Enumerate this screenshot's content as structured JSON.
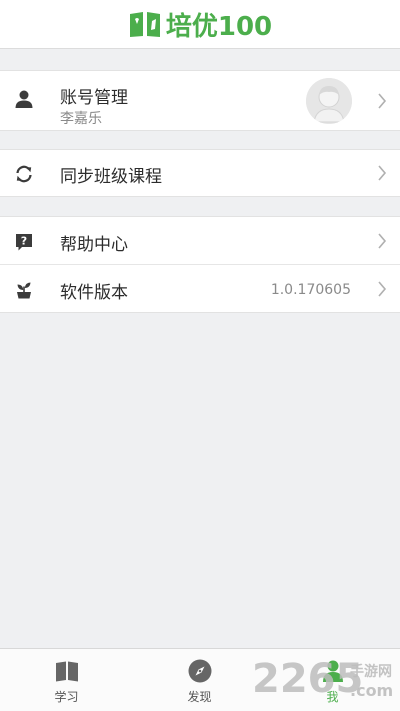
{
  "header": {
    "app_title": "培优100",
    "logo_icon": "book-logo-icon",
    "brand_color": "#4cae4c"
  },
  "account": {
    "label": "账号管理",
    "username": "李嘉乐",
    "icon": "person-icon",
    "avatar_icon": "avatar-placeholder-icon"
  },
  "sync": {
    "label": "同步班级课程",
    "icon": "sync-icon"
  },
  "help": {
    "label": "帮助中心",
    "icon": "help-icon"
  },
  "version": {
    "label": "软件版本",
    "value": "1.0.170605",
    "icon": "plant-icon"
  },
  "tabs": [
    {
      "label": "学习",
      "icon": "book-icon",
      "active": false
    },
    {
      "label": "发现",
      "icon": "compass-icon",
      "active": false
    },
    {
      "label": "我",
      "icon": "me-icon",
      "active": true
    }
  ],
  "watermark": {
    "brand_number": "2265",
    "site_text": "手游网",
    "domain_text": ".com"
  }
}
